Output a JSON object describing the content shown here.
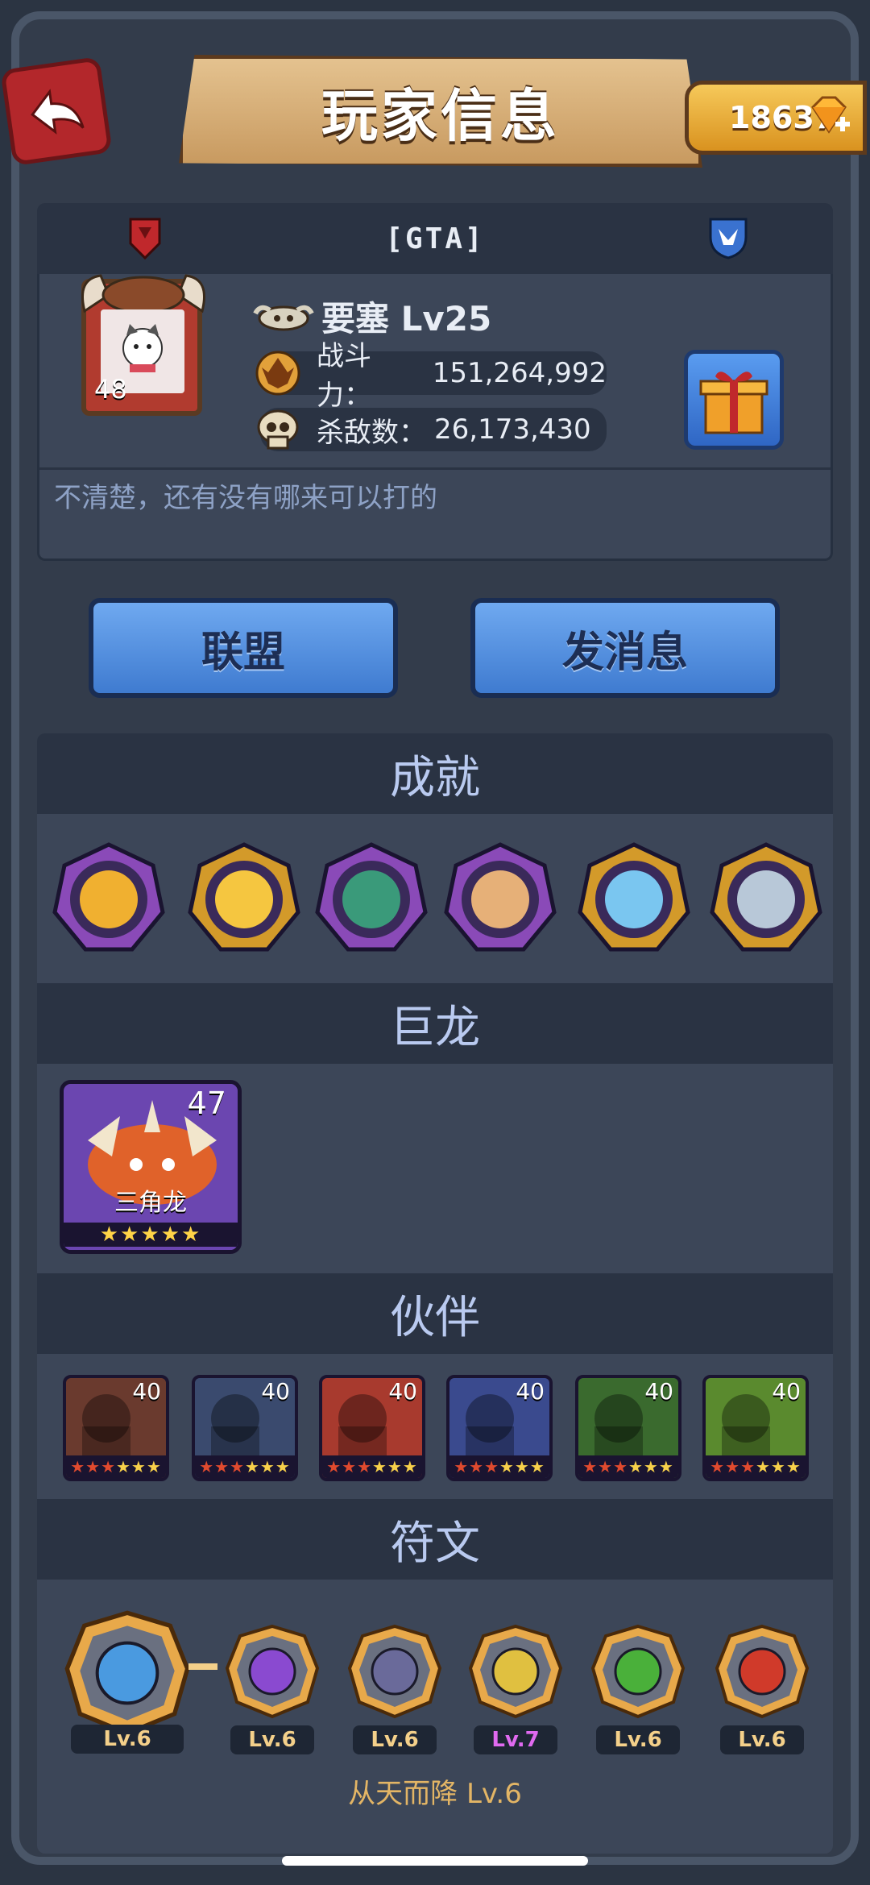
{
  "header": {
    "title": "玩家信息",
    "gems": "18637",
    "back_icon": "back-arrow-icon",
    "gem_icon": "diamond-plus-icon"
  },
  "profile": {
    "guild_tag": "[GTA]",
    "avatar_level": "48",
    "name": "要塞 Lv25",
    "power_label": "战斗力：",
    "power_value": "151,264,992",
    "kills_label": "杀敌数：",
    "kills_value": "26,173,430",
    "signature": "不清楚，还有没有哪来可以打的"
  },
  "actions": {
    "alliance_label": "联盟",
    "message_label": "发消息"
  },
  "achievements": {
    "title": "成就",
    "items": [
      {
        "icon": "golden-horn-badge",
        "ring": "#8a4ab8"
      },
      {
        "icon": "gold-nugget-badge",
        "ring": "#d39a2a"
      },
      {
        "icon": "sword-slime-badge",
        "ring": "#8a4ab8"
      },
      {
        "icon": "crowned-face-badge",
        "ring": "#8a4ab8"
      },
      {
        "icon": "ice-beast-badge",
        "ring": "#d39a2a"
      },
      {
        "icon": "spiked-gear-badge",
        "ring": "#d39a2a"
      }
    ]
  },
  "dragons": {
    "title": "巨龙",
    "items": [
      {
        "name": "三角龙",
        "level": "47",
        "stars": "★★★★★"
      }
    ]
  },
  "companions": {
    "title": "伙伴",
    "items": [
      {
        "level": "40",
        "color": "#6a3a2e"
      },
      {
        "level": "40",
        "color": "#3a4a6e"
      },
      {
        "level": "40",
        "color": "#a83a2e"
      },
      {
        "level": "40",
        "color": "#3a4a8e"
      },
      {
        "level": "40",
        "color": "#3a6a2e"
      },
      {
        "level": "40",
        "color": "#5a8a2e"
      }
    ]
  },
  "runes": {
    "title": "符文",
    "items": [
      {
        "level": "Lv.6",
        "color": "#4a9ae0",
        "icon": "x-rune-icon"
      },
      {
        "level": "Lv.6",
        "color": "#8a4ad0",
        "icon": "swirl-rune-icon"
      },
      {
        "level": "Lv.6",
        "color": "#6a6a9a",
        "icon": "gate-rune-icon"
      },
      {
        "level": "Lv.7",
        "color": "#e0c040",
        "icon": "drop-rune-icon"
      },
      {
        "level": "Lv.6",
        "color": "#4ab03a",
        "icon": "chevron-rune-icon"
      },
      {
        "level": "Lv.6",
        "color": "#d03a2a",
        "icon": "hammer-rune-icon"
      }
    ],
    "footer": "从天而降 Lv.6"
  }
}
